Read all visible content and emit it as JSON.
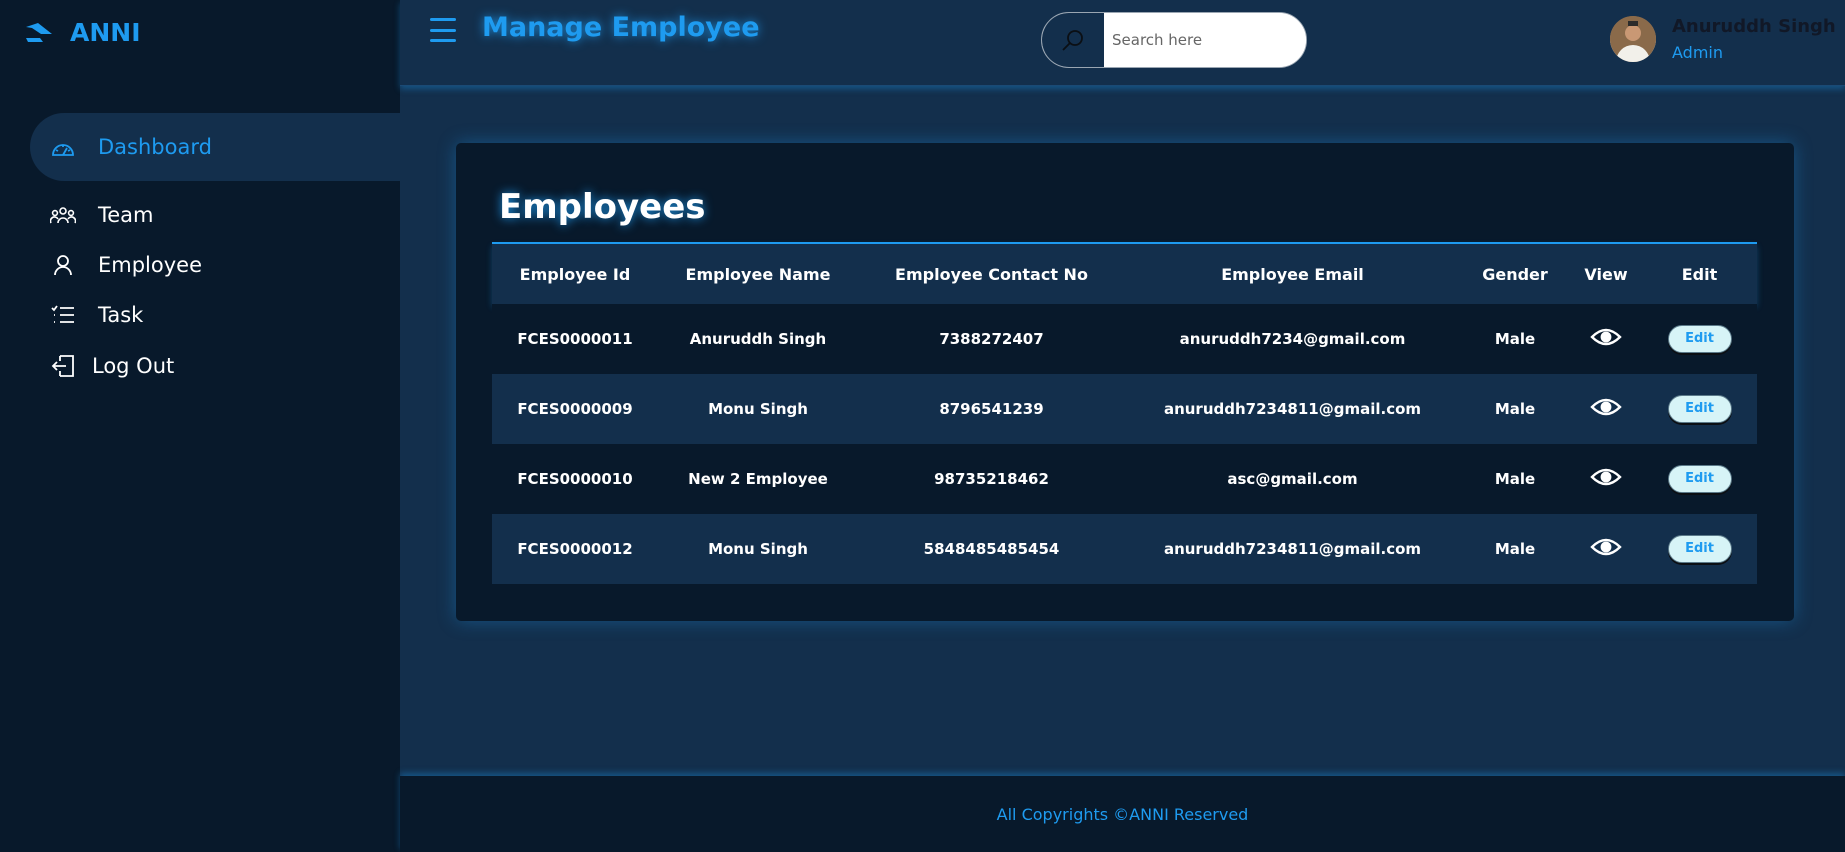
{
  "brand": {
    "name": "ANNI"
  },
  "sidebar": {
    "items": [
      {
        "label": "Dashboard",
        "icon": "dashboard-icon",
        "active": true
      },
      {
        "label": "Team",
        "icon": "team-icon"
      },
      {
        "label": "Employee",
        "icon": "user-icon"
      },
      {
        "label": "Task",
        "icon": "task-list-icon"
      },
      {
        "label": "Log Out",
        "icon": "logout-icon"
      }
    ]
  },
  "header": {
    "title": "Manage Employee",
    "search_placeholder": "Search here",
    "user": {
      "name": "Anuruddh Singh",
      "role": "Admin"
    }
  },
  "main": {
    "title": "Employees",
    "columns": [
      "Employee Id",
      "Employee Name",
      "Employee Contact No",
      "Employee Email",
      "Gender",
      "View",
      "Edit"
    ],
    "rows": [
      {
        "id": "FCES0000011",
        "name": "Anuruddh Singh",
        "contact": "7388272407",
        "email": "anuruddh7234@gmail.com",
        "gender": "Male",
        "edit": "Edit"
      },
      {
        "id": "FCES0000009",
        "name": "Monu Singh",
        "contact": "8796541239",
        "email": "anuruddh7234811@gmail.com",
        "gender": "Male",
        "edit": "Edit"
      },
      {
        "id": "FCES0000010",
        "name": "New 2 Employee",
        "contact": "98735218462",
        "email": "asc@gmail.com",
        "gender": "Male",
        "edit": "Edit"
      },
      {
        "id": "FCES0000012",
        "name": "Monu Singh",
        "contact": "5848485485454",
        "email": "anuruddh7234811@gmail.com",
        "gender": "Male",
        "edit": "Edit"
      }
    ]
  },
  "footer": {
    "text": "All Copyrights ©ANNI Reserved"
  },
  "colors": {
    "accent": "#1e9bf0",
    "sidebar_bg": "#08192b",
    "main_bg": "#132f4c",
    "edit_bg": "#d7f4f7"
  }
}
